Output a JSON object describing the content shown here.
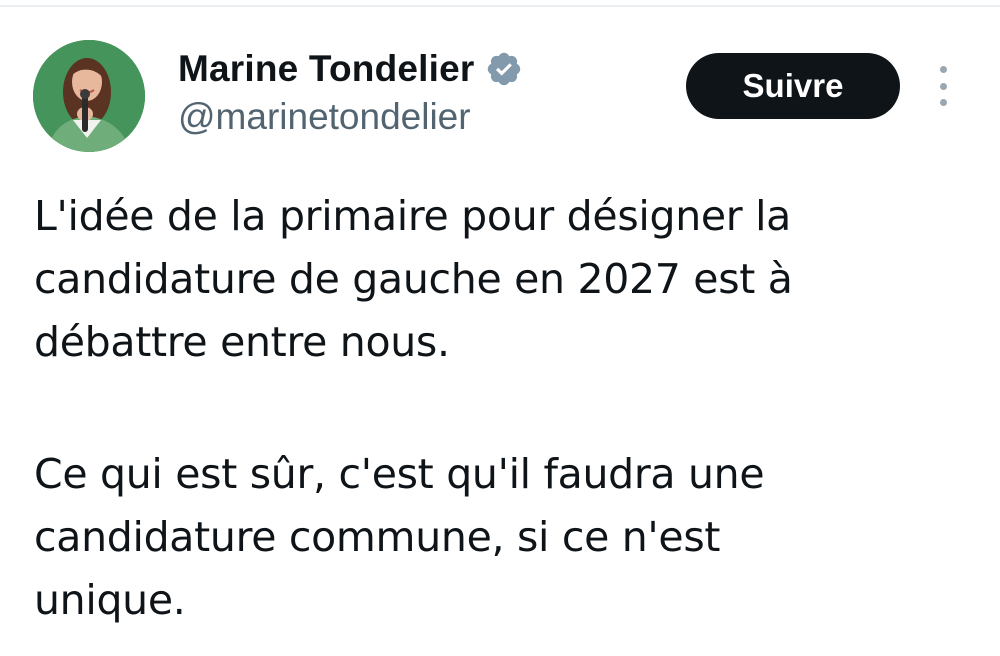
{
  "tweet": {
    "author": {
      "display_name": "Marine Tondelier",
      "handle": "@marinetondelier",
      "verified": true,
      "avatar_icon": "profile-photo"
    },
    "actions": {
      "follow_label": "Suivre",
      "more_icon": "vertical-ellipsis-icon"
    },
    "text": {
      "paragraph_1": "L'idée de la primaire pour désigner la\ncandidature de gauche en 2027 est à\ndébattre entre nous.",
      "paragraph_2": "Ce qui est sûr, c'est qu'il faudra une\ncandidature commune, si ce n'est\nunique."
    }
  },
  "colors": {
    "text_primary": "#0f1419",
    "text_secondary": "#536471",
    "follow_button_bg": "#0f1419",
    "verified_badge": "#829aab",
    "avatar_bg": "#3f8f57"
  }
}
